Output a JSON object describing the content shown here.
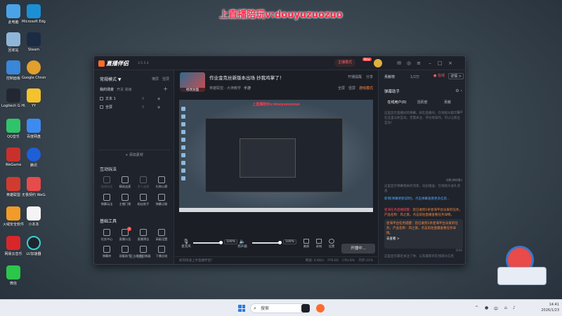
{
  "banner": "上直播陪玩v:douyuzuozuo",
  "desktop": {
    "icons": [
      {
        "label": "此电脑",
        "color": "#4aa3e8"
      },
      {
        "label": "回收站",
        "color": "#8fb6d9"
      },
      {
        "label": "控制面板",
        "color": "#3a86d8"
      },
      {
        "label": "Logitech G HUB",
        "color": "#222831"
      },
      {
        "label": "QQ音乐",
        "color": "#30c46a"
      },
      {
        "label": "WeGame",
        "color": "#c9302c"
      },
      {
        "label": "英雄联盟",
        "color": "#d13b2f"
      },
      {
        "label": "火绒安全软件",
        "color": "#f39b28"
      },
      {
        "label": "网易云音乐",
        "color": "#d9262b"
      },
      {
        "label": "微信",
        "color": "#2bc64a"
      },
      {
        "label": "Microsoft Edge",
        "color": "#1b8fd6"
      },
      {
        "label": "Steam",
        "color": "#1b2b44"
      },
      {
        "label": "Google Chrome",
        "color": "#e1a02b"
      },
      {
        "label": "YY",
        "color": "#f3c22d"
      },
      {
        "label": "百度网盘",
        "color": "#3d8bf0"
      },
      {
        "label": "腾讯",
        "color": "#1e5fd6"
      },
      {
        "label": "无畏契约 WeGame版",
        "color": "#e84b4b"
      },
      {
        "label": "小本本",
        "color": "#f4f4f4"
      },
      {
        "label": "LU加速器",
        "color": "#1e2430"
      }
    ]
  },
  "app": {
    "name": "直播伴侣",
    "version": "3.5.5.4",
    "mode_tag": "主播模式",
    "new_badge": "New",
    "mode": "常规模式 ▼",
    "links": [
      "横屏",
      "竖屏"
    ],
    "scene_tabs": {
      "active": "我的场景",
      "others": "开关",
      "other2": "高级"
    },
    "scenes": [
      "文本 1",
      "全屏"
    ],
    "add_source": "+ 添加素材",
    "interact_title": "互动玩法",
    "interact_tools": [
      {
        "label": "连线玩法",
        "dim": true
      },
      {
        "label": "精选连麦",
        "dim": false
      },
      {
        "label": "多人连线",
        "dim": true
      },
      {
        "label": "礼物心愿",
        "dim": false
      },
      {
        "label": "弹幕玩法",
        "dim": false
      },
      {
        "label": "主播门票",
        "dim": false
      },
      {
        "label": "粉丝助手",
        "dim": false
      },
      {
        "label": "弹幕点歌",
        "dim": false
      }
    ],
    "basic_title": "基础工具",
    "basic_tools": [
      {
        "label": "任务中心",
        "badge": ""
      },
      {
        "label": "直播公告",
        "badge": "1"
      },
      {
        "label": "直播预告",
        "badge": ""
      },
      {
        "label": "高级设置",
        "badge": ""
      },
      {
        "label": "弹幕库",
        "badge": ""
      },
      {
        "label": "观看助手",
        "badge": ""
      },
      {
        "label": "场景切换器",
        "badge": ""
      },
      {
        "label": "下播总结",
        "badge": ""
      }
    ],
    "more": "··· 更多功能"
  },
  "center": {
    "thumb_label": "修改封面",
    "title": "作业金克丝新版本出场 抄我鸡掌了！",
    "share": [
      "开播提醒",
      "分享"
    ],
    "category": "英雄联盟 - 大神教学",
    "category_kind": "手游",
    "options": [
      "全屏",
      "竖屏",
      "游戏模式"
    ],
    "preview_banner": "上直播陪玩v:douyuzuozuo",
    "mic_label": "麦克风",
    "mic_pct": "100%",
    "speaker_label": "扬声器",
    "speaker_pct": "100%",
    "minis": [
      "美颜",
      "录制",
      "设置"
    ],
    "golive": "开播中...",
    "status_left": "如何快速上手直播伴侣？",
    "status_right": [
      "网速: 0 KB/s",
      "FPS:60",
      "CPU:8%",
      "内存:31%",
      "码率:2000 Kbps"
    ]
  },
  "right": {
    "title": "贡献榜",
    "count": "1/2万",
    "tag": "● 在线",
    "detail": "详情 >",
    "danmu_title": "弹幕助手",
    "tabs": [
      "在线用户(0)",
      "活跃度",
      "贡献"
    ],
    "hint1": "这里显示直播间的弹幕，如在直播间，在线观众都可以在这里与你互动，无需关注、评论等操作，可以让粉丝互动！",
    "count1": "0.0",
    "count2": "0条(共0条)",
    "hint2": "这里显示弹幕相关的消息、动态推送、在线观众送礼消息",
    "notice1": "新增[弹幕更新说明]，点击弹幕查看更多信息...",
    "notice2_a": "星海任务直播提醒：",
    "notice2_b": "您已收到1条星海平台派发的任务，产品名称：风之旅，",
    "notice2_c": "点击前往直播查看任务详情，",
    "sys": "星海平台任务提醒：您已收到1条星海平台派发的任务，产品名称：风之旅，点击前往直播查看任务详情。",
    "sys_view": "去查看 >",
    "wordcount": "0/40",
    "foot": "这里显示最近关注了你、以及最新的在线观众信息"
  },
  "taskbar": {
    "search_placeholder": "搜索",
    "time": "14:41",
    "date": "2026/1/23"
  }
}
